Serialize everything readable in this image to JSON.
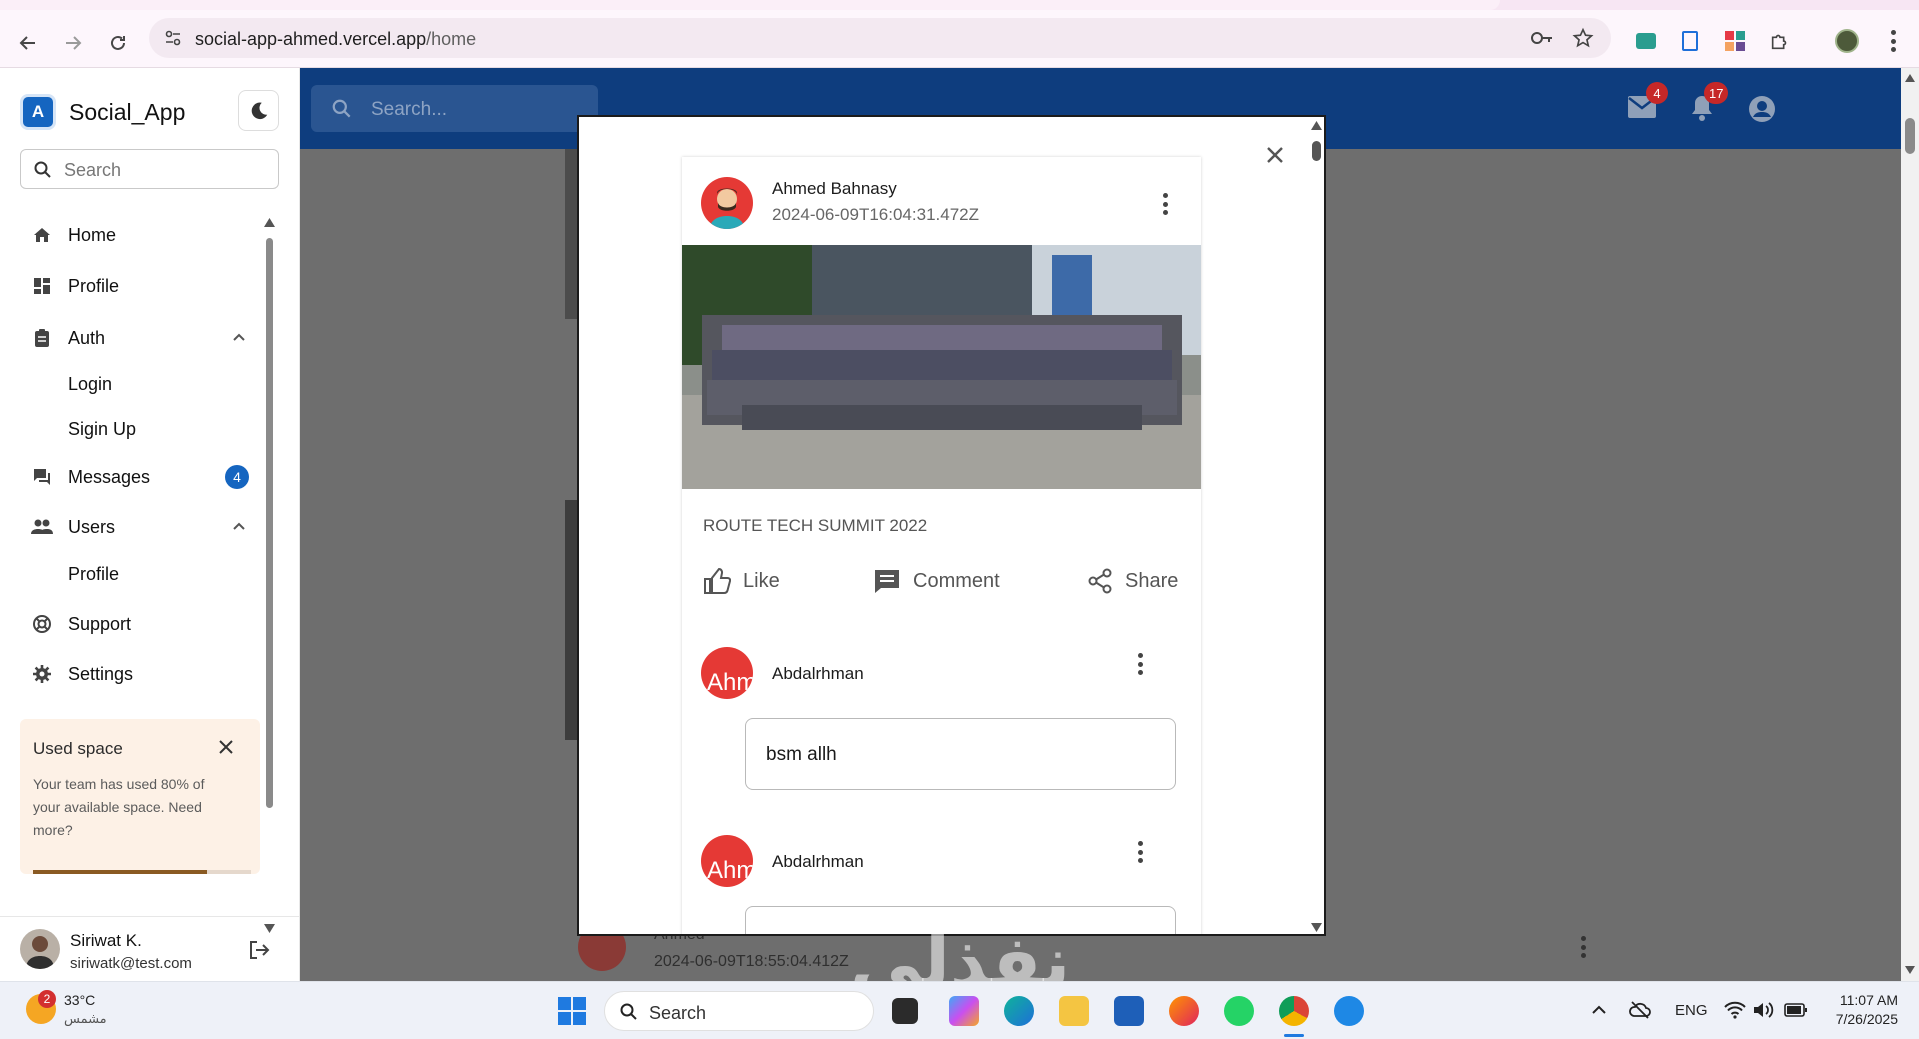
{
  "browser": {
    "url_host": "social-app-ahmed.vercel.app",
    "url_path": "/home"
  },
  "sidebar": {
    "brand": "Social_App",
    "search_placeholder": "Search",
    "items": [
      {
        "label": "Home",
        "icon": "home-icon"
      },
      {
        "label": "Profile",
        "icon": "dashboard-icon"
      },
      {
        "label": "Auth",
        "icon": "clipboard-icon"
      },
      {
        "label": "Login"
      },
      {
        "label": "Sigin Up"
      },
      {
        "label": "Messages",
        "icon": "forum-icon",
        "badge": "4"
      },
      {
        "label": "Users",
        "icon": "people-icon"
      },
      {
        "label": "Profile"
      },
      {
        "label": "Support",
        "icon": "support-icon"
      },
      {
        "label": "Settings",
        "icon": "gear-icon"
      }
    ],
    "used_space": {
      "title": "Used space",
      "description": "Your team has used 80% of your available space. Need more?",
      "progress": 0.8
    },
    "user": {
      "name": "Siriwat K.",
      "email": "siriwatk@test.com"
    }
  },
  "appbar": {
    "search_placeholder": "Search...",
    "mail_count": "4",
    "notification_count": "17"
  },
  "modal": {
    "post": {
      "author": "Ahmed Bahnasy",
      "timestamp": "2024-06-09T16:04:31.472Z",
      "caption": "ROUTE TECH SUMMIT 2022",
      "actions": {
        "like": "Like",
        "comment": "Comment",
        "share": "Share"
      }
    },
    "comments": [
      {
        "author": "Abdalrhman",
        "avatar_alt": "Ahm",
        "text": "bsm allh"
      },
      {
        "author": "Abdalrhman",
        "avatar_alt": "Ahm",
        "text": "..."
      }
    ]
  },
  "background_post": {
    "author": "Ahmed",
    "timestamp": "2024-06-09T18:55:04.412Z"
  },
  "watermark": "نفذلي",
  "taskbar": {
    "weather_temp": "33°C",
    "weather_desc": "مشمس",
    "weather_badge": "2",
    "search_placeholder": "Search",
    "language": "ENG",
    "time": "11:07 AM",
    "date": "7/26/2025"
  },
  "colors": {
    "appbar": "#0e3d7e",
    "accent": "#1565c0",
    "badge": "#c62828",
    "avatar": "#e53935"
  }
}
